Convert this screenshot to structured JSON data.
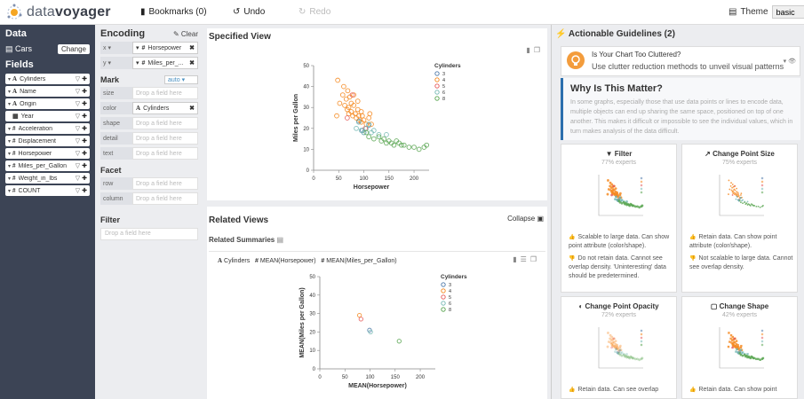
{
  "topbar": {
    "app_name_prefix": "data",
    "app_name_suffix": "voyager",
    "bookmarks": "Bookmarks (0)",
    "undo": "Undo",
    "redo": "Redo",
    "theme_label": "Theme",
    "theme_value": "basic"
  },
  "data_pane": {
    "title": "Data",
    "dataset": "Cars",
    "change": "Change",
    "fields_title": "Fields",
    "fields": [
      {
        "type": "A",
        "name": "Cylinders"
      },
      {
        "type": "A",
        "name": "Name"
      },
      {
        "type": "A",
        "name": "Origin"
      },
      {
        "type": "cal",
        "name": "Year"
      },
      {
        "type": "#",
        "name": "Acceleration"
      },
      {
        "type": "#",
        "name": "Displacement"
      },
      {
        "type": "#",
        "name": "Horsepower"
      },
      {
        "type": "#",
        "name": "Miles_per_Gallon"
      },
      {
        "type": "#",
        "name": "Weight_in_lbs"
      },
      {
        "type": "#",
        "name": "COUNT"
      }
    ]
  },
  "encoding": {
    "title": "Encoding",
    "clear": "Clear",
    "x": {
      "channel": "x",
      "field": "Horsepower"
    },
    "y": {
      "channel": "y",
      "field": "Miles_per_..."
    },
    "mark_title": "Mark",
    "mark_value": "auto",
    "channels": [
      {
        "channel": "size",
        "value": "Drop a field here",
        "filled": false
      },
      {
        "channel": "color",
        "value": "Cylinders",
        "filled": true
      },
      {
        "channel": "shape",
        "value": "Drop a field here",
        "filled": false
      },
      {
        "channel": "detail",
        "value": "Drop a field here",
        "filled": false
      },
      {
        "channel": "text",
        "value": "Drop a field here",
        "filled": false
      }
    ],
    "facet_title": "Facet",
    "facets": [
      {
        "channel": "row",
        "value": "Drop a field here"
      },
      {
        "channel": "column",
        "value": "Drop a field here"
      }
    ],
    "filter_title": "Filter",
    "filter_placeholder": "Drop a field here"
  },
  "specified_view": {
    "title": "Specified View",
    "legend_title": "Cylinders",
    "legend": [
      "3",
      "4",
      "5",
      "6",
      "8"
    ],
    "xlabel": "Horsepower",
    "ylabel": "Miles per Gallon",
    "xticks": [
      "0",
      "50",
      "100",
      "150",
      "200"
    ],
    "yticks": [
      "0",
      "10",
      "20",
      "30",
      "40",
      "50"
    ]
  },
  "related_views": {
    "title": "Related Views",
    "collapse": "Collapse",
    "summaries_title": "Related Summaries",
    "card_header": {
      "field1": "Cylinders",
      "field2": "MEAN(Horsepower)",
      "field3": "MEAN(Miles_per_Gallon)"
    },
    "legend_title": "Cylinders",
    "legend": [
      "3",
      "4",
      "5",
      "6",
      "8"
    ],
    "xlabel": "MEAN(Horsepower)",
    "ylabel": "MEAN(Miles per Gallon)",
    "xticks": [
      "0",
      "50",
      "100",
      "150",
      "200"
    ],
    "yticks": [
      "0",
      "10",
      "20",
      "30",
      "40",
      "50"
    ]
  },
  "guidelines": {
    "title": "Actionable Guidelines (2)",
    "alert_title": "Is Your Chart Too Cluttered?",
    "alert_body": "Use clutter reduction methods to unveil visual patterns",
    "why_title": "Why Is This Matter?",
    "why_body": "In some graphs, especially those that use data points or lines to encode data, multiple objects can end up sharing the same space, positioned on top of one another. This makes it difficult or impossible to see the individual values, which in turn makes analysis of the data difficult.",
    "cards": [
      {
        "title": "Filter",
        "experts": "77% experts",
        "pro": "Scalable to large data. Can show point attribute (color/shape).",
        "con": "Do not retain data. Cannot see overlap density. 'Uninteresting' data should be predetermined."
      },
      {
        "title": "Change Point Size",
        "experts": "75% experts",
        "pro": "Retain data. Can show point attribute (color/shape).",
        "con": "Not scalable to large data. Cannot see overlap density."
      },
      {
        "title": "Change Point Opacity",
        "experts": "72% experts",
        "pro": "Retain data. Can see overlap",
        "con": ""
      },
      {
        "title": "Change Shape",
        "experts": "42% experts",
        "pro": "Retain data. Can show point",
        "con": ""
      }
    ]
  },
  "colors": {
    "c3": "#4c78a8",
    "c4": "#f58518",
    "c5": "#e45756",
    "c6": "#72b7b2",
    "c8": "#54a24b",
    "sidebar": "#3c4455",
    "accent": "#2c6fad"
  },
  "chart_data": [
    {
      "type": "scatter",
      "title": "",
      "xlabel": "Horsepower",
      "ylabel": "Miles per Gallon",
      "xlim": [
        0,
        230
      ],
      "ylim": [
        0,
        50
      ],
      "series": [
        {
          "name": "3",
          "points": [
            [
              90,
              23.5
            ],
            [
              97,
              19
            ],
            [
              100,
              18
            ],
            [
              110,
              21.5
            ]
          ]
        },
        {
          "name": "4",
          "points": [
            [
              46,
              26
            ],
            [
              48,
              43
            ],
            [
              52,
              32
            ],
            [
              58,
              36
            ],
            [
              60,
              40
            ],
            [
              62,
              31
            ],
            [
              65,
              34
            ],
            [
              67,
              29
            ],
            [
              68,
              38
            ],
            [
              70,
              30
            ],
            [
              70,
              27
            ],
            [
              72,
              35
            ],
            [
              75,
              28
            ],
            [
              75,
              32
            ],
            [
              78,
              26
            ],
            [
              80,
              31
            ],
            [
              80,
              36
            ],
            [
              83,
              27
            ],
            [
              85,
              25
            ],
            [
              88,
              29
            ],
            [
              88,
              33
            ],
            [
              90,
              26
            ],
            [
              92,
              24
            ],
            [
              95,
              28
            ],
            [
              95,
              23
            ],
            [
              97,
              26
            ],
            [
              100,
              24
            ],
            [
              105,
              22
            ],
            [
              110,
              25
            ],
            [
              112,
              27
            ],
            [
              115,
              22
            ]
          ]
        },
        {
          "name": "5",
          "points": [
            [
              67,
              25
            ],
            [
              77,
              36
            ],
            [
              103,
              20
            ]
          ]
        },
        {
          "name": "6",
          "points": [
            [
              85,
              20
            ],
            [
              90,
              23
            ],
            [
              95,
              19
            ],
            [
              100,
              18
            ],
            [
              105,
              20
            ],
            [
              110,
              22
            ],
            [
              115,
              18
            ],
            [
              120,
              19
            ],
            [
              130,
              17
            ],
            [
              145,
              17
            ]
          ]
        },
        {
          "name": "8",
          "points": [
            [
              105,
              18
            ],
            [
              110,
              16
            ],
            [
              120,
              15
            ],
            [
              130,
              16
            ],
            [
              135,
              14
            ],
            [
              140,
              15
            ],
            [
              145,
              13
            ],
            [
              150,
              14
            ],
            [
              155,
              13
            ],
            [
              160,
              12
            ],
            [
              165,
              14
            ],
            [
              170,
              13
            ],
            [
              175,
              12
            ],
            [
              180,
              12
            ],
            [
              190,
              11
            ],
            [
              200,
              11
            ],
            [
              210,
              10
            ],
            [
              220,
              11
            ],
            [
              225,
              12
            ]
          ]
        }
      ]
    },
    {
      "type": "scatter",
      "title": "",
      "xlabel": "MEAN(Horsepower)",
      "ylabel": "MEAN(Miles per Gallon)",
      "xlim": [
        0,
        230
      ],
      "ylim": [
        0,
        50
      ],
      "series": [
        {
          "name": "3",
          "points": [
            [
              99,
              21
            ]
          ]
        },
        {
          "name": "4",
          "points": [
            [
              79,
              29
            ]
          ]
        },
        {
          "name": "5",
          "points": [
            [
              82,
              27
            ]
          ]
        },
        {
          "name": "6",
          "points": [
            [
              101,
              20
            ]
          ]
        },
        {
          "name": "8",
          "points": [
            [
              158,
              15
            ]
          ]
        }
      ]
    }
  ]
}
